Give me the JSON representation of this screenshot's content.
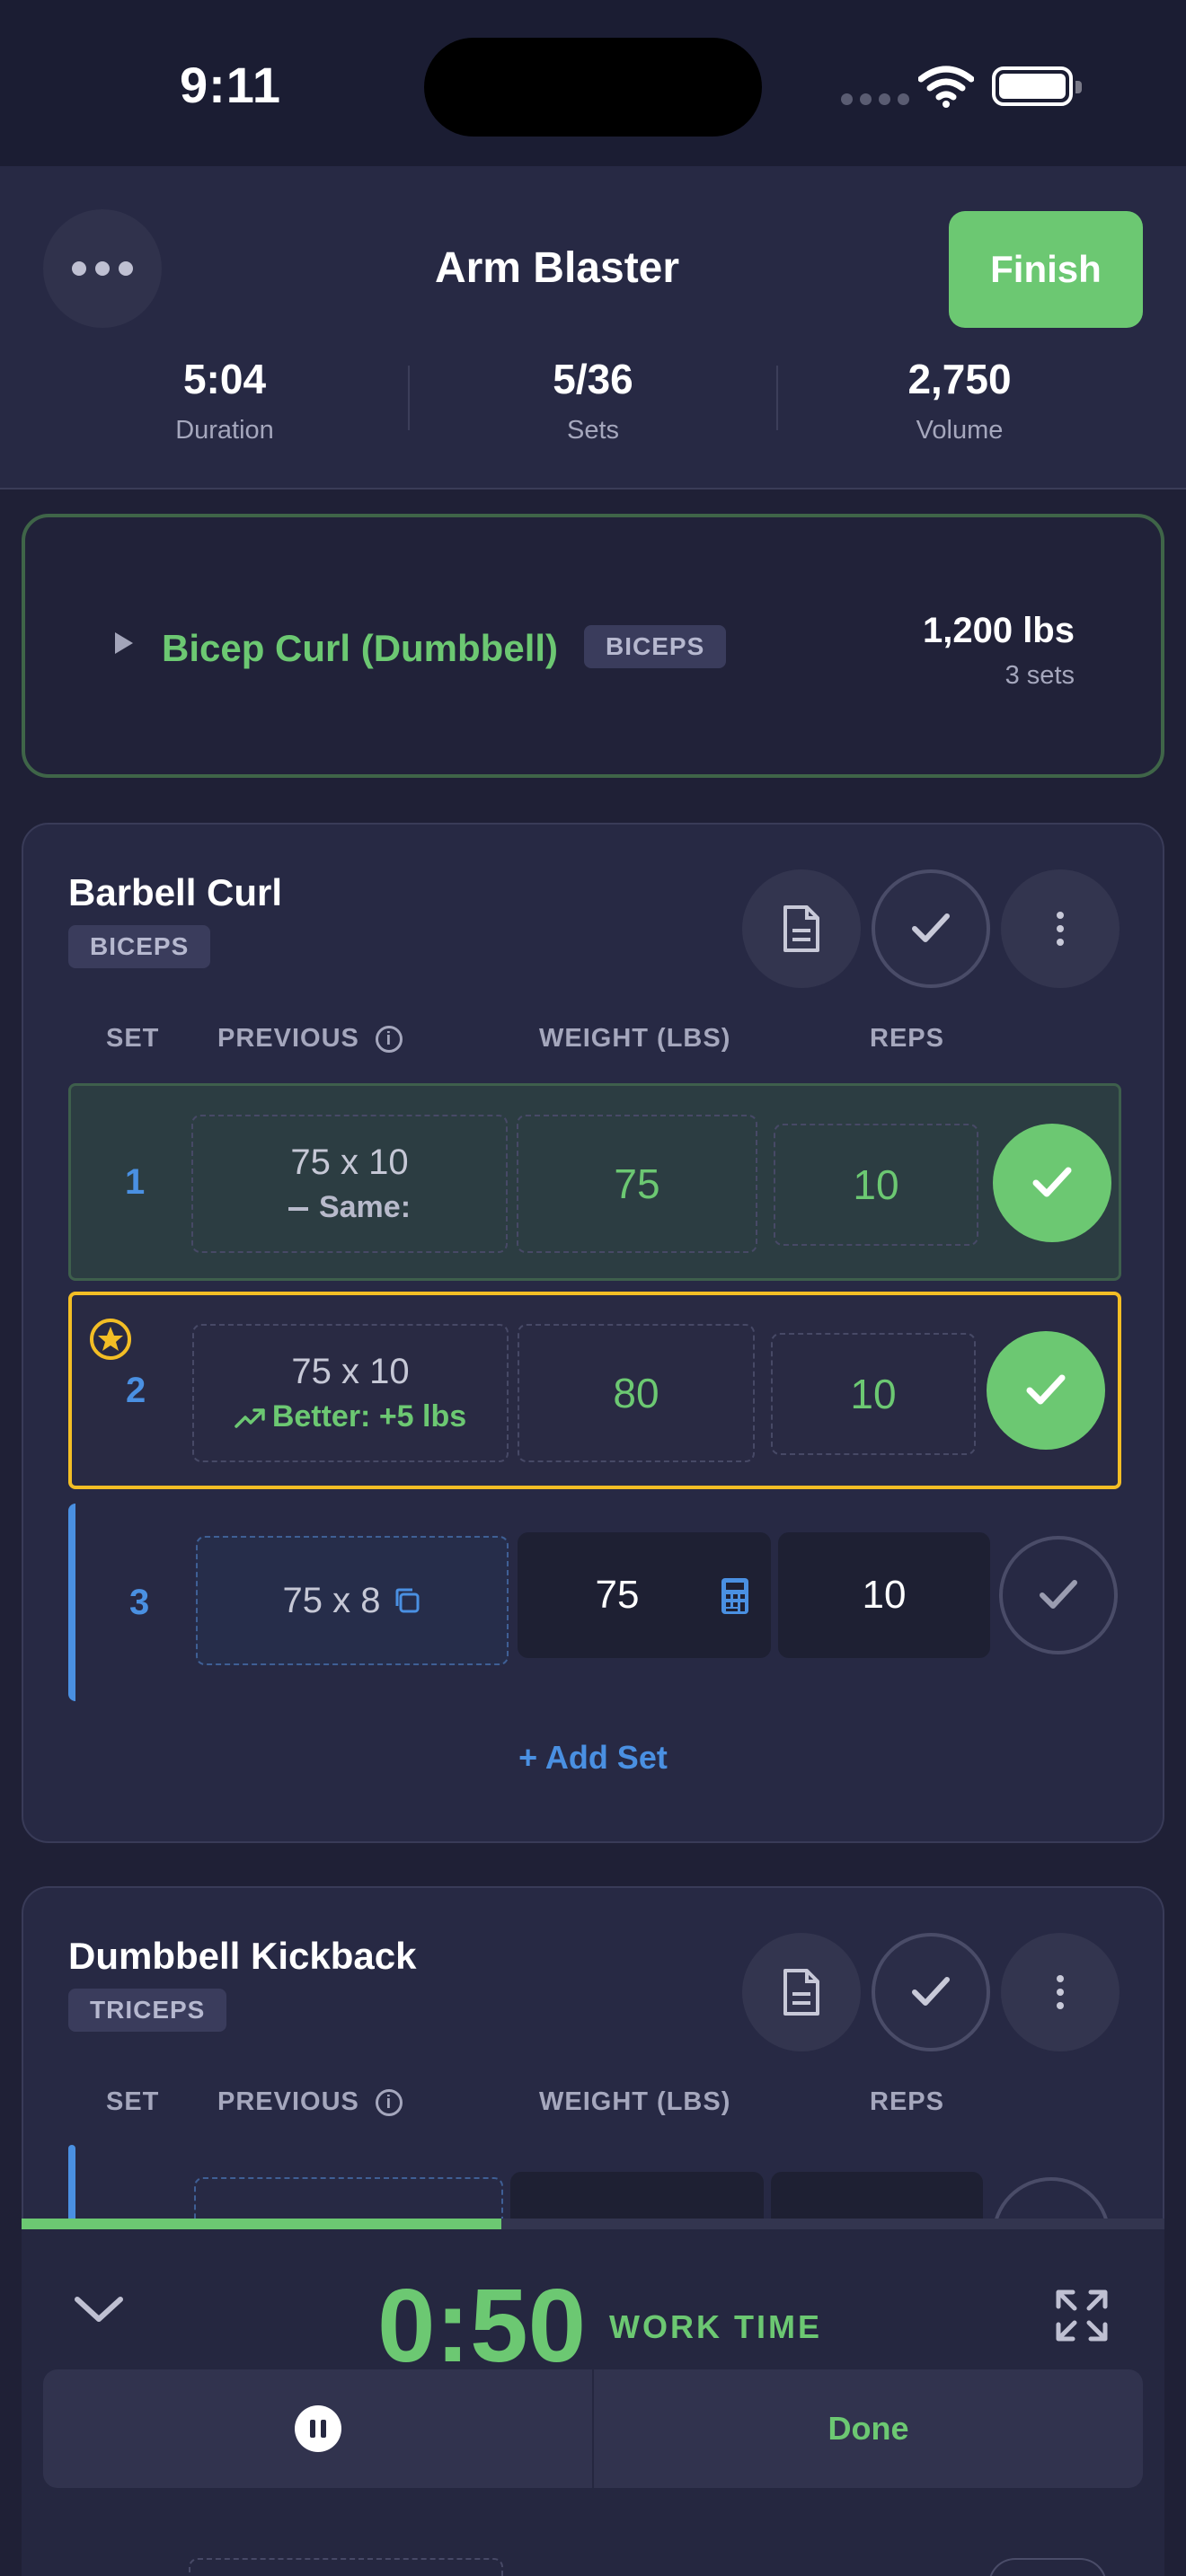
{
  "status_bar": {
    "time": "9:11"
  },
  "header": {
    "title": "Arm Blaster",
    "finish_label": "Finish",
    "stats": [
      {
        "value": "5:04",
        "label": "Duration"
      },
      {
        "value": "5/36",
        "label": "Sets"
      },
      {
        "value": "2,750",
        "label": "Volume"
      }
    ]
  },
  "collapsed_exercise": {
    "name": "Bicep Curl (Dumbbell)",
    "tag": "BICEPS",
    "volume": "1,200 lbs",
    "sets": "3 sets"
  },
  "columns": {
    "set": "SET",
    "previous": "PREVIOUS",
    "weight": "WEIGHT (LBS)",
    "reps": "REPS",
    "info": "i"
  },
  "exercise1": {
    "name": "Barbell Curl",
    "tag": "BICEPS",
    "add_set": "+ Add Set",
    "rows": [
      {
        "set": "1",
        "previous": "75 x 10",
        "comparison": "Same:",
        "weight": "75",
        "reps": "10",
        "status": "done"
      },
      {
        "set": "2",
        "previous": "75 x 10",
        "comparison": "Better: +5 lbs",
        "weight": "80",
        "reps": "10",
        "status": "done-pr"
      },
      {
        "set": "3",
        "previous": "75 x 8",
        "comparison": "",
        "weight": "75",
        "reps": "10",
        "status": "active"
      }
    ]
  },
  "exercise2": {
    "name": "Dumbbell Kickback",
    "tag": "TRICEPS"
  },
  "timer": {
    "time": "0:50",
    "label": "WORK TIME",
    "done_label": "Done",
    "progress": 0.42
  },
  "colors": {
    "accent_green": "#6cc872",
    "accent_blue": "#4a90e2",
    "pr_gold": "#f3be25",
    "background": "#1f2036"
  }
}
